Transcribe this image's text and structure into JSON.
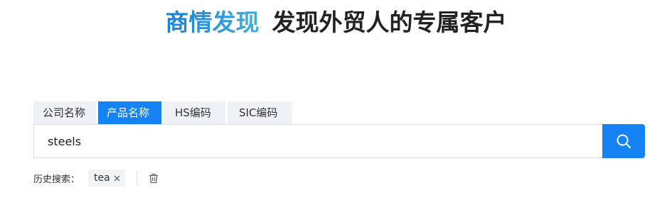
{
  "header": {
    "brand": "商情发现",
    "slogan": "发现外贸人的专属客户"
  },
  "tabs": [
    {
      "label": "公司名称",
      "active": false
    },
    {
      "label": "产品名称",
      "active": true
    },
    {
      "label": "HS编码",
      "active": false
    },
    {
      "label": "SIC编码",
      "active": false
    }
  ],
  "search": {
    "value": "steels",
    "button_icon": "search-icon"
  },
  "history": {
    "label": "历史搜索：",
    "items": [
      {
        "text": "tea",
        "close_icon": "close-icon"
      }
    ],
    "clear_icon": "trash-icon"
  },
  "colors": {
    "accent": "#1583f3",
    "brand_gradient_start": "#1a7fd8",
    "brand_gradient_end": "#3fb0d8",
    "tab_inactive_bg": "#eef1f6",
    "tag_bg": "#f2f3f5"
  }
}
